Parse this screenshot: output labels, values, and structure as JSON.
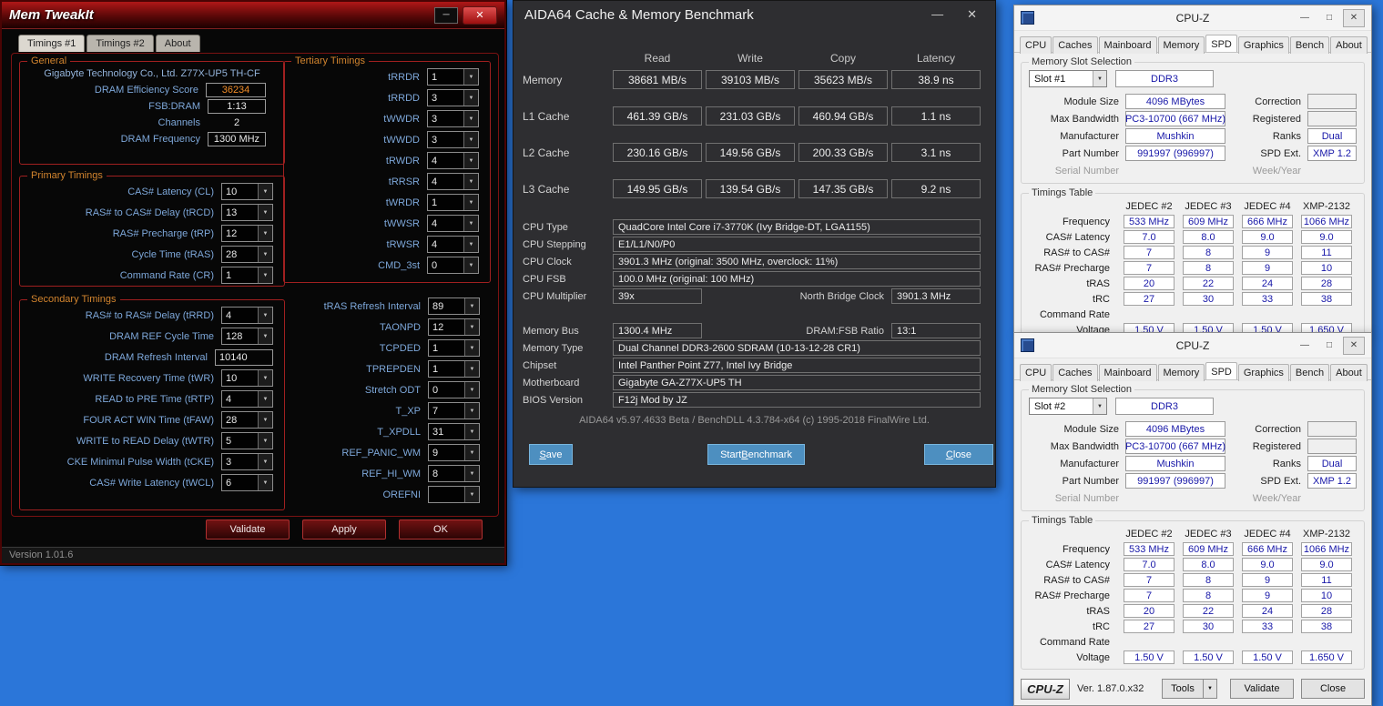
{
  "colors": {
    "desktop_bg": "#2b76d9",
    "memtweakit_accent_red": "#a02020",
    "memtweakit_score_orange": "#f08c28",
    "memtweakit_label_blue": "#7da7d9",
    "aida_button_blue": "#4d8fc0",
    "cpuz_value_blue": "#1717a8"
  },
  "icons": {
    "dropdown": "▼",
    "minimize": "─",
    "minimize_thin": "—",
    "maximize": "□",
    "close": "✕",
    "close_thin": "✕"
  },
  "memtweakit": {
    "title": "Mem TweakIt",
    "statusbar": "Version 1.01.6",
    "buttons": [
      "Validate",
      "Apply",
      "OK"
    ],
    "tabs": [
      {
        "label": "Timings #1",
        "active": true
      },
      {
        "label": "Timings #2",
        "active": false
      },
      {
        "label": "About",
        "active": false
      }
    ],
    "general": {
      "title": "General",
      "board_name": "Gigabyte Technology Co., Ltd. Z77X-UP5 TH-CF",
      "rows": [
        {
          "label": "DRAM Efficiency Score",
          "value": "36234",
          "style": "score"
        },
        {
          "label": "FSB:DRAM",
          "value": "1:13",
          "style": "box"
        },
        {
          "label": "Channels",
          "value": "2",
          "style": "plain"
        },
        {
          "label": "DRAM Frequency",
          "value": "1300 MHz",
          "style": "box"
        }
      ]
    },
    "primary": {
      "title": "Primary Timings",
      "rows": [
        {
          "label": "CAS# Latency (CL)",
          "value": "10"
        },
        {
          "label": "RAS# to CAS# Delay (tRCD)",
          "value": "13"
        },
        {
          "label": "RAS# Precharge (tRP)",
          "value": "12"
        },
        {
          "label": "Cycle Time (tRAS)",
          "value": "28"
        },
        {
          "label": "Command Rate (CR)",
          "value": "1"
        }
      ]
    },
    "secondary": {
      "title": "Secondary Timings",
      "rows": [
        {
          "label": "RAS# to RAS# Delay (tRRD)",
          "value": "4"
        },
        {
          "label": "DRAM REF Cycle Time",
          "value": "128"
        },
        {
          "label": "DRAM Refresh Interval",
          "value": "10140",
          "style": "wide"
        },
        {
          "label": "WRITE Recovery Time (tWR)",
          "value": "10"
        },
        {
          "label": "READ to PRE Time (tRTP)",
          "value": "4"
        },
        {
          "label": "FOUR ACT WIN Time (tFAW)",
          "value": "28"
        },
        {
          "label": "WRITE to READ Delay (tWTR)",
          "value": "5"
        },
        {
          "label": "CKE Minimul Pulse Width (tCKE)",
          "value": "3"
        },
        {
          "label": "CAS# Write Latency (tWCL)",
          "value": "6"
        }
      ]
    },
    "tertiary": {
      "title": "Tertiary Timings",
      "rows": [
        {
          "label": "tRRDR",
          "value": "1"
        },
        {
          "label": "tRRDD",
          "value": "3"
        },
        {
          "label": "tWWDR",
          "value": "3"
        },
        {
          "label": "tWWDD",
          "value": "3"
        },
        {
          "label": "tRWDR",
          "value": "4"
        },
        {
          "label": "tRRSR",
          "value": "4"
        },
        {
          "label": "tWRDR",
          "value": "1"
        },
        {
          "label": "tWWSR",
          "value": "4"
        },
        {
          "label": "tRWSR",
          "value": "4"
        },
        {
          "label": "CMD_3st",
          "value": "0"
        }
      ]
    },
    "misc": {
      "rows": [
        {
          "label": "tRAS Refresh Interval",
          "value": "89"
        },
        {
          "label": "TAONPD",
          "value": "12"
        },
        {
          "label": "TCPDED",
          "value": "1"
        },
        {
          "label": "TPREPDEN",
          "value": "1"
        },
        {
          "label": "Stretch ODT",
          "value": "0"
        },
        {
          "label": "T_XP",
          "value": "7"
        },
        {
          "label": "T_XPDLL",
          "value": "31"
        },
        {
          "label": "REF_PANIC_WM",
          "value": "9"
        },
        {
          "label": "REF_HI_WM",
          "value": "8"
        },
        {
          "label": "OREFNI",
          "value": ""
        }
      ]
    }
  },
  "aida64": {
    "title": "AIDA64 Cache & Memory Benchmark",
    "bench": {
      "columns": [
        "Read",
        "Write",
        "Copy",
        "Latency"
      ],
      "rows": [
        {
          "label": "Memory",
          "values": [
            "38681 MB/s",
            "39103 MB/s",
            "35623 MB/s",
            "38.9 ns"
          ]
        },
        {
          "label": "L1 Cache",
          "values": [
            "461.39 GB/s",
            "231.03 GB/s",
            "460.94 GB/s",
            "1.1 ns"
          ]
        },
        {
          "label": "L2 Cache",
          "values": [
            "230.16 GB/s",
            "149.56 GB/s",
            "200.33 GB/s",
            "3.1 ns"
          ]
        },
        {
          "label": "L3 Cache",
          "values": [
            "149.95 GB/s",
            "139.54 GB/s",
            "147.35 GB/s",
            "9.2 ns"
          ]
        }
      ]
    },
    "info": [
      {
        "label": "CPU Type",
        "value": "QuadCore Intel Core i7-3770K  (Ivy Bridge-DT, LGA1155)"
      },
      {
        "label": "CPU Stepping",
        "value": "E1/L1/N0/P0"
      },
      {
        "label": "CPU Clock",
        "value": "3901.3 MHz  (original: 3500 MHz, overclock: 11%)"
      },
      {
        "label": "CPU FSB",
        "value": "100.0 MHz  (original: 100 MHz)"
      },
      {
        "label": "CPU Multiplier",
        "value": "39x",
        "split": true,
        "label2": "North Bridge Clock",
        "value2": "3901.3 MHz"
      },
      {
        "label": "Memory Bus",
        "value": "1300.4 MHz",
        "split": true,
        "label2": "DRAM:FSB Ratio",
        "value2": "13:1"
      },
      {
        "label": "Memory Type",
        "value": "Dual Channel DDR3-2600 SDRAM  (10-13-12-28 CR1)"
      },
      {
        "label": "Chipset",
        "value": "Intel Panther Point Z77, Intel Ivy Bridge"
      },
      {
        "label": "Motherboard",
        "value": "Gigabyte GA-Z77X-UP5 TH"
      },
      {
        "label": "BIOS Version",
        "value": "F12j Mod by JZ"
      }
    ],
    "footer": "AIDA64 v5.97.4633 Beta / BenchDLL 4.3.784-x64  (c) 1995-2018 FinalWire Ltd.",
    "buttons": [
      {
        "name": "save",
        "pre": "",
        "key": "S",
        "post": "ave"
      },
      {
        "name": "start-benchmark",
        "pre": "Start ",
        "key": "B",
        "post": "enchmark"
      },
      {
        "name": "close",
        "pre": "",
        "key": "C",
        "post": "lose"
      }
    ]
  },
  "cpuz": {
    "title": "CPU-Z",
    "tabs": [
      "CPU",
      "Caches",
      "Mainboard",
      "Memory",
      "SPD",
      "Graphics",
      "Bench",
      "About"
    ],
    "active_tab": "SPD",
    "slot_section_title": "Memory Slot Selection",
    "memory_type": "DDR3",
    "instances": [
      {
        "slot": "Slot #1"
      },
      {
        "slot": "Slot #2"
      }
    ],
    "fields": [
      {
        "label": "Module Size",
        "value": "4096 MBytes",
        "box": true,
        "label2": "Correction",
        "value2": "",
        "box2": true
      },
      {
        "label": "Max Bandwidth",
        "value": "PC3-10700 (667 MHz)",
        "box": true,
        "label2": "Registered",
        "value2": "",
        "box2": true
      },
      {
        "label": "Manufacturer",
        "value": "Mushkin",
        "box": true,
        "label2": "Ranks",
        "value2": "Dual",
        "box2": true
      },
      {
        "label": "Part Number",
        "value": "991997 (996997)",
        "box": true,
        "label2": "SPD Ext.",
        "value2": "XMP 1.2",
        "box2": true
      },
      {
        "label": "Serial Number",
        "value": "",
        "box": false,
        "muted": true,
        "label2": "Week/Year",
        "value2": "",
        "box2": false,
        "muted2": true
      }
    ],
    "timings": {
      "title": "Timings Table",
      "columns": [
        "JEDEC #2",
        "JEDEC #3",
        "JEDEC #4",
        "XMP-2132"
      ],
      "rows": [
        {
          "label": "Frequency",
          "values": [
            "533 MHz",
            "609 MHz",
            "666 MHz",
            "1066 MHz"
          ]
        },
        {
          "label": "CAS# Latency",
          "values": [
            "7.0",
            "8.0",
            "9.0",
            "9.0"
          ]
        },
        {
          "label": "RAS# to CAS#",
          "values": [
            "7",
            "8",
            "9",
            "11"
          ]
        },
        {
          "label": "RAS# Precharge",
          "values": [
            "7",
            "8",
            "9",
            "10"
          ]
        },
        {
          "label": "tRAS",
          "values": [
            "20",
            "22",
            "24",
            "28"
          ]
        },
        {
          "label": "tRC",
          "values": [
            "27",
            "30",
            "33",
            "38"
          ]
        },
        {
          "label": "Command Rate",
          "values": [
            "",
            "",
            "",
            ""
          ],
          "boxes": false
        },
        {
          "label": "Voltage",
          "values": [
            "1.50 V",
            "1.50 V",
            "1.50 V",
            "1.650 V"
          ]
        }
      ]
    },
    "footer": {
      "logo": "CPU-Z",
      "version": "Ver. 1.87.0.x32",
      "tools": "Tools",
      "validate": "Validate",
      "close": "Close"
    }
  }
}
